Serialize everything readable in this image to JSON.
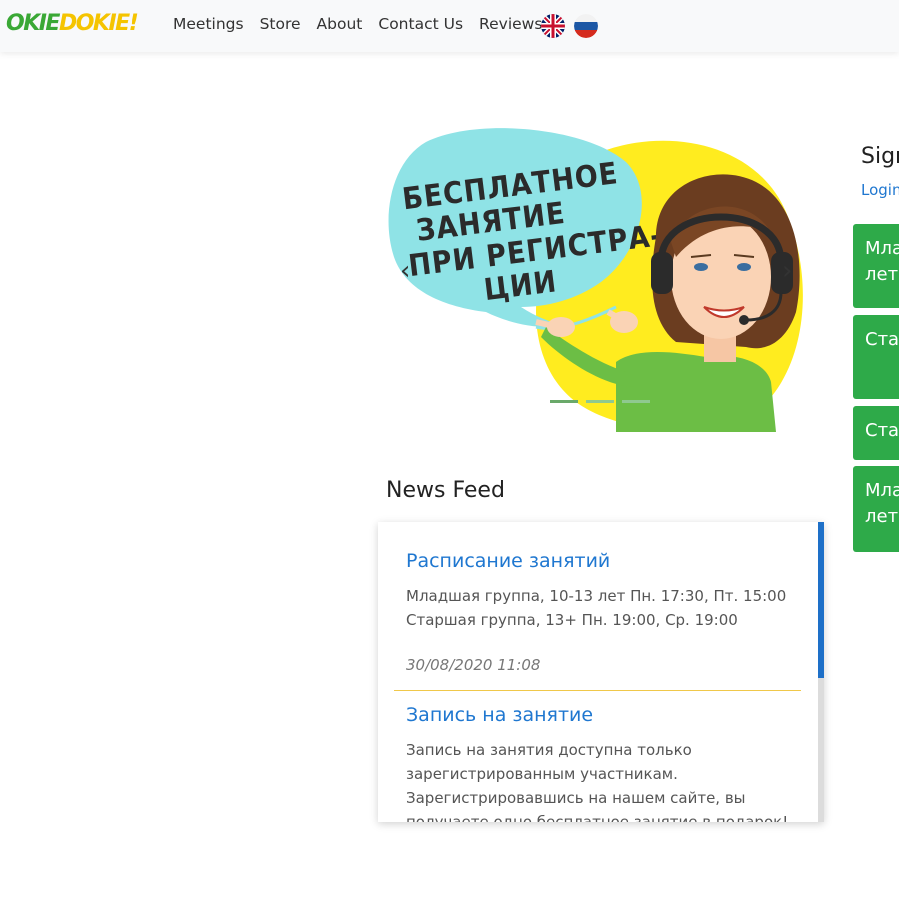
{
  "header": {
    "logo_part1": "OKIE",
    "logo_part2": "DOKIE!",
    "nav": [
      "Meetings",
      "Store",
      "About",
      "Contact Us",
      "Reviews"
    ],
    "languages": [
      "uk-flag-icon",
      "russia-flag-icon"
    ]
  },
  "hero": {
    "bubble_lines": [
      "БЕСПЛАТНОЕ",
      "ЗАНЯТИЕ",
      "ПРИ РЕГИСТРА-",
      "ЦИИ"
    ],
    "prev_icon": "chevron-left-icon",
    "next_icon": "chevron-right-icon",
    "prev_glyph": "‹",
    "next_glyph": "›",
    "slides": 3
  },
  "news": {
    "heading": "News Feed",
    "items": [
      {
        "title": "Расписание занятий",
        "lines": [
          "Младшая группа, 10-13 лет Пн. 17:30, Пт. 15:00",
          "Старшая группа, 13+ Пн. 19:00, Ср. 19:00"
        ],
        "date": "30/08/2020 11:08"
      },
      {
        "title": "Запись на занятие",
        "lines": [
          "Запись на занятия доступна только",
          "зарегистрированным участникам.",
          "Зарегистрировавшись на нашем сайте, вы",
          "получаете одно бесплатное занятие в подарок!"
        ]
      }
    ]
  },
  "sidebar": {
    "title": "Sign",
    "login": "Login",
    "boxes": [
      {
        "line1": "Мла",
        "line2": "лет"
      },
      {
        "line1": "Ста",
        "line2": ""
      },
      {
        "line1": "Ста",
        "line2": ""
      },
      {
        "line1": "Мла",
        "line2": "лет"
      }
    ]
  },
  "colors": {
    "accent_green": "#2eaa49",
    "link_blue": "#1f77d0",
    "hero_yellow": "#ffec1f",
    "bubble_cyan": "#8fe3e6"
  }
}
